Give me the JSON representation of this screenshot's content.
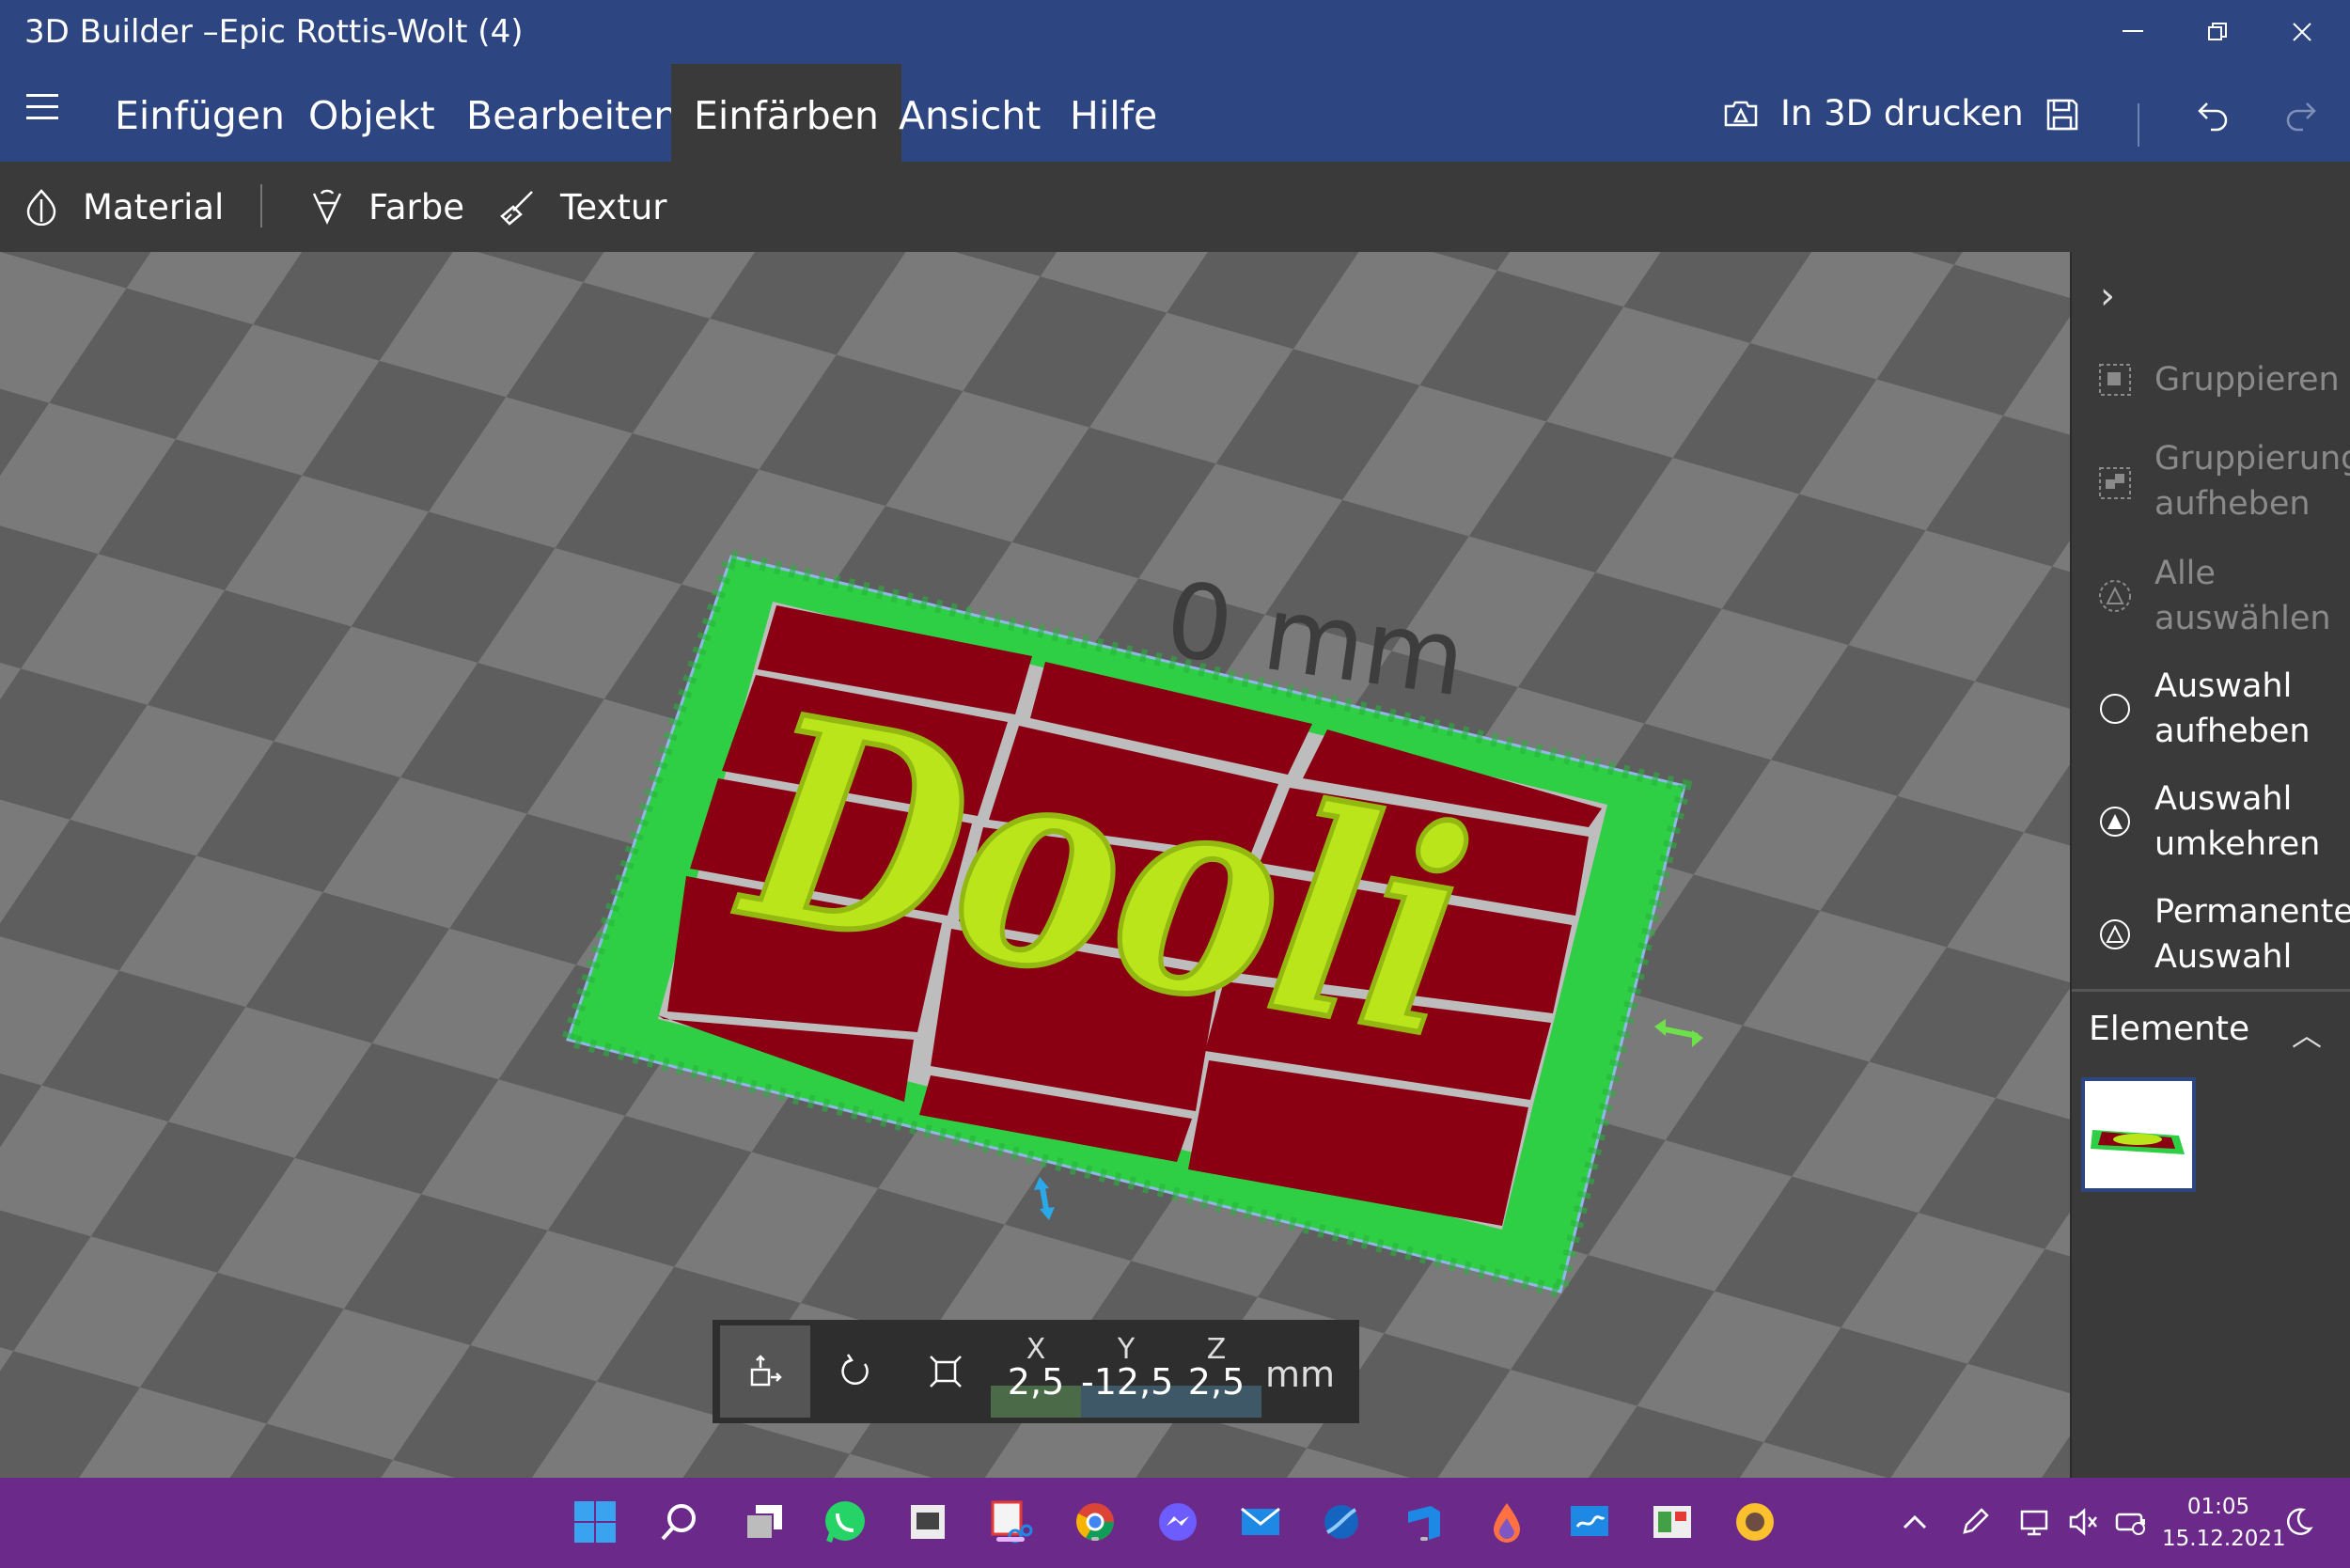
{
  "window": {
    "title": "3D Builder –Epic Rottis-Wolt (4)",
    "controls": [
      "minimize",
      "maximize",
      "close"
    ]
  },
  "menu": {
    "items": [
      "Einfügen",
      "Objekt",
      "Bearbeiten",
      "Einfärben",
      "Ansicht",
      "Hilfe"
    ],
    "active": "Einfärben",
    "print_label": "In 3D drucken"
  },
  "ribbon": {
    "material": "Material",
    "farbe": "Farbe",
    "textur": "Textur"
  },
  "viewport": {
    "dimension_label": "0 mm",
    "object_text": "Dooli",
    "colors": {
      "base_green": "#2fcf45",
      "tiles_red": "#8a0012",
      "letters_lime": "#b9e51a",
      "grid_light": "#7a7a7a",
      "grid_dark": "#5e5e5e"
    }
  },
  "transform": {
    "x_label": "X",
    "x_value": "2,5",
    "y_label": "Y",
    "y_value": "-12,5",
    "z_label": "Z",
    "z_value": "2,5",
    "unit": "mm"
  },
  "panel": {
    "gruppieren": "Gruppieren",
    "gruppierung_aufheben": "Gruppierung aufheben",
    "alle_auswaehlen": "Alle auswählen",
    "auswahl_aufheben": "Auswahl aufheben",
    "auswahl_umkehren": "Auswahl umkehren",
    "permanente_auswahl": "Permanente Auswahl",
    "elemente": "Elemente"
  },
  "taskbar": {
    "time": "01:05",
    "date": "15.12.2021",
    "accent": "#6b2a8a"
  }
}
